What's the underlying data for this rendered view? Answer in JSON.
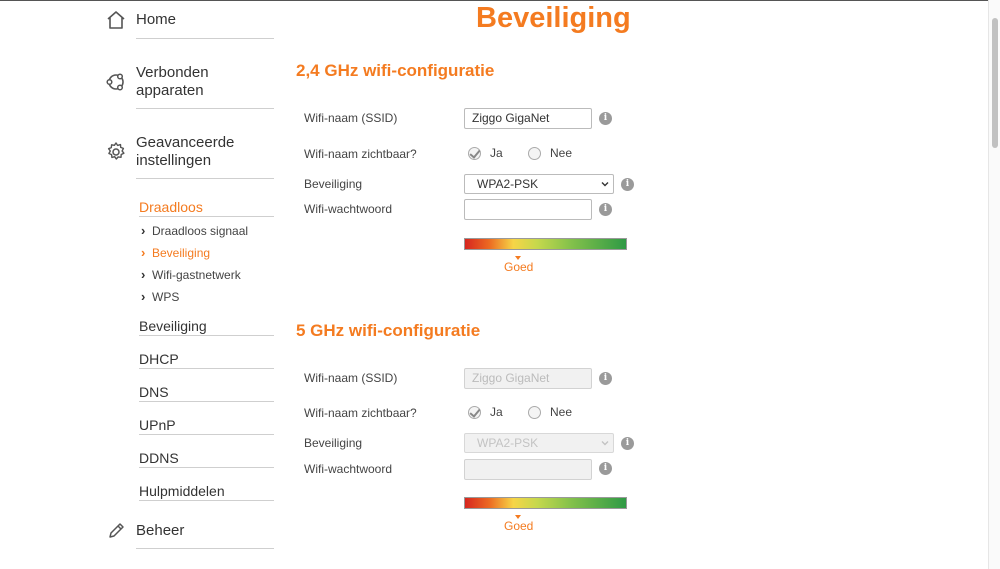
{
  "page": {
    "title": "Beveiliging"
  },
  "sidebar": {
    "home": {
      "label": "Home",
      "icon": "home-icon"
    },
    "connected": {
      "label_line1": "Verbonden",
      "label_line2": "apparaten",
      "icon": "devices-icon"
    },
    "advanced": {
      "label_line1": "Geavanceerde",
      "label_line2": "instellingen",
      "icon": "gear-icon"
    },
    "manage": {
      "label": "Beheer",
      "icon": "pencil-icon"
    },
    "wireless": {
      "label": "Draadloos",
      "children": [
        {
          "label": "Draadloos signaal",
          "active": false
        },
        {
          "label": "Beveiliging",
          "active": true
        },
        {
          "label": "Wifi-gastnetwerk",
          "active": false
        },
        {
          "label": "WPS",
          "active": false
        }
      ]
    },
    "sections": [
      {
        "label": "Beveiliging"
      },
      {
        "label": "DHCP"
      },
      {
        "label": "DNS"
      },
      {
        "label": "UPnP"
      },
      {
        "label": "DDNS"
      },
      {
        "label": "Hulpmiddelen"
      }
    ]
  },
  "wifi24": {
    "title": "2,4 GHz wifi-configuratie",
    "ssid_label": "Wifi-naam (SSID)",
    "ssid_value": "Ziggo GigaNet",
    "visible_label": "Wifi-naam zichtbaar?",
    "yes_label": "Ja",
    "no_label": "Nee",
    "visible_selected": "Ja",
    "security_label": "Beveiliging",
    "security_value": "WPA2-PSK",
    "password_label": "Wifi-wachtwoord",
    "password_value": "",
    "strength_label": "Goed",
    "disabled": false
  },
  "wifi5": {
    "title": "5 GHz wifi-configuratie",
    "ssid_label": "Wifi-naam (SSID)",
    "ssid_value": "Ziggo GigaNet",
    "visible_label": "Wifi-naam zichtbaar?",
    "yes_label": "Ja",
    "no_label": "Nee",
    "visible_selected": "Ja",
    "security_label": "Beveiliging",
    "security_value": "WPA2-PSK",
    "password_label": "Wifi-wachtwoord",
    "password_value": "",
    "strength_label": "Goed",
    "disabled": true
  },
  "info_glyph": "i",
  "colors": {
    "accent": "#f47b20",
    "text": "#333333",
    "separator": "#cfcfcf",
    "info": "#9a9a9a"
  }
}
